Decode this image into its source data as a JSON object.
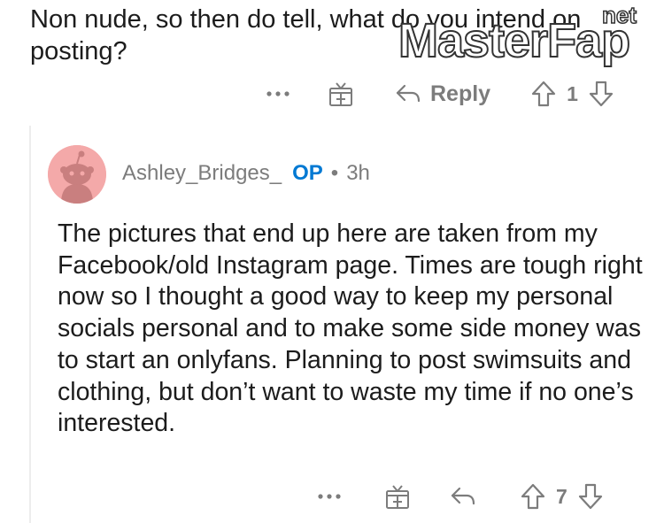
{
  "parent_comment": {
    "text": "Non nude, so then do tell, what do you intend on posting?",
    "actions": {
      "more_label": "•••",
      "reply_label": "Reply",
      "vote_count": "1"
    }
  },
  "watermark": {
    "text": "MasterFap",
    "suffix": "net"
  },
  "reply_comment": {
    "username": "Ashley_Bridges_",
    "op_badge": "OP",
    "separator": "•",
    "time": "3h",
    "body": "The pictures that end up here are taken from my Facebook/old Instagram page. Times are tough right now so I thought a good way to keep my personal socials personal and to make some side money was to start an onlyfans. Planning to post swimsuits and clothing, but don’t want to waste my time if no one’s interested.",
    "actions": {
      "more_label": "•••",
      "vote_count": "7"
    }
  },
  "colors": {
    "op_badge": "#0079d3",
    "muted": "#7c7c7c",
    "avatar_bg": "#f4a9a9",
    "watermark_blue": "#3b82f6"
  },
  "icons": [
    "more-icon",
    "award-icon",
    "reply-arrow-icon",
    "upvote-icon",
    "downvote-icon",
    "snoo-avatar-icon"
  ]
}
